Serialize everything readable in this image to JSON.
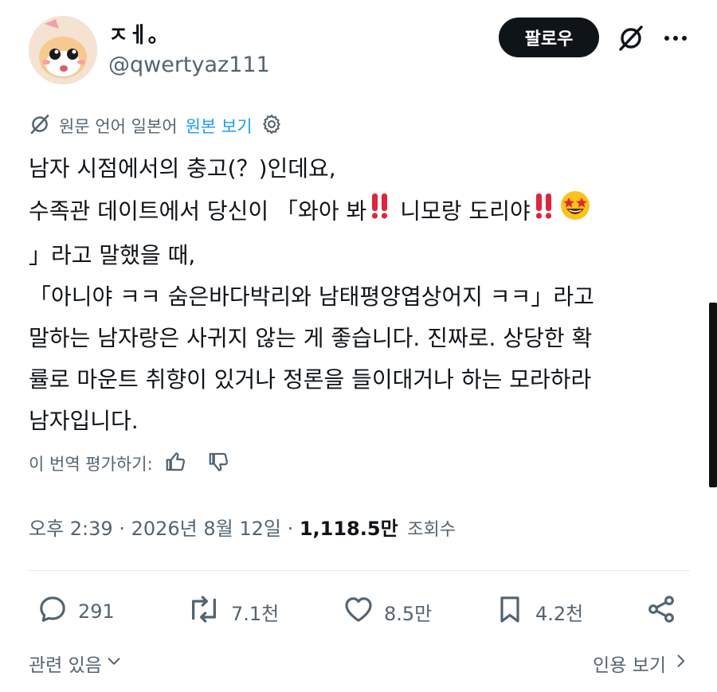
{
  "header": {
    "display_name": "ㅈㅔ。",
    "handle": "@qwertyaz111",
    "follow_label": "팔로우"
  },
  "translation": {
    "source_text": "원문 언어 일본어",
    "show_original": "원본 보기"
  },
  "tweet": {
    "lines": [
      "남자 시점에서의 충고(？)인데요,",
      "수족관 데이트에서 당신이 「와아 봐",
      "니모랑 도리야",
      "」라고 말했을 때,",
      "「아니야 ㅋㅋ 숨은바다박리와 남태평양엽상어지 ㅋㅋ」라고",
      "말하는 남자랑은 사귀지 않는 게 좋습니다. 진짜로. 상당한 확",
      "률로 마운트 취향이 있거나 정론을 들이대거나 하는 모라하라",
      "남자입니다."
    ]
  },
  "rate": {
    "label": "이 번역 평가하기:"
  },
  "meta": {
    "time": "오후 2:39 · 2026년 8월 12일 · ",
    "views_count": "1,118.5만",
    "views_label": "조회수"
  },
  "actions": {
    "replies": "291",
    "reposts": "7.1천",
    "likes": "8.5만",
    "bookmarks": "4.2천"
  },
  "footer": {
    "related": "관련 있음",
    "quotes": "인용 보기"
  },
  "icons": {
    "accent": "#1d9bf0",
    "muted": "#536471",
    "emoji_double_exclamation": "‼",
    "emoji_star_struck": "star-struck"
  }
}
